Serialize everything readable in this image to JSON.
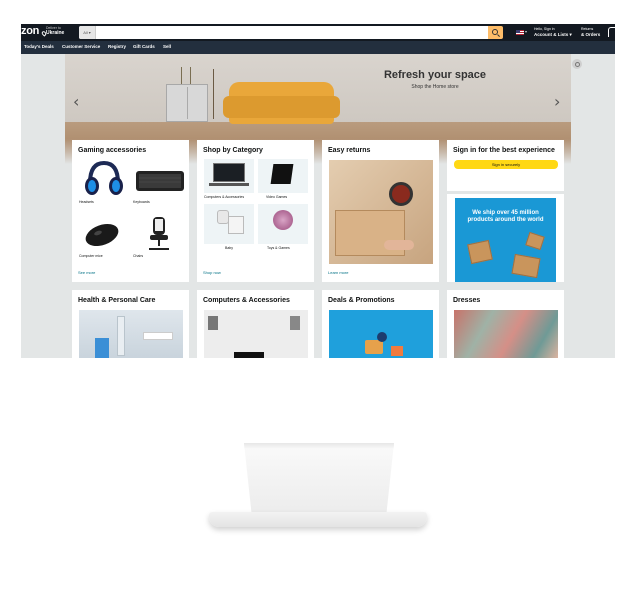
{
  "header": {
    "logo_text": "zon",
    "deliver_label": "Deliver to",
    "deliver_location": "Ukraine",
    "search_category": "All ▾",
    "search_placeholder": "",
    "account_greeting": "Hello, Sign in",
    "account_label": "Account & Lists ▾",
    "returns_label": "Returns",
    "orders_label": "& Orders",
    "flag_dropdown": "▾"
  },
  "subnav": {
    "items": [
      "Today's Deals",
      "Customer Service",
      "Registry",
      "Gift Cards",
      "Sell"
    ]
  },
  "hero": {
    "title": "Refresh your space",
    "subtitle": "Shop the Home store",
    "prev_arrow": "‹",
    "next_arrow": "›"
  },
  "cards": {
    "gaming": {
      "title": "Gaming accessories",
      "cells": [
        "Headsets",
        "Keyboards",
        "Computer mice",
        "Chairs"
      ],
      "link": "See more"
    },
    "category": {
      "title": "Shop by Category",
      "cells": [
        "Computers & Accessories",
        "Video Games",
        "Baby",
        "Toys & Games"
      ],
      "link": "Shop now"
    },
    "returns": {
      "title": "Easy returns",
      "link": "Learn more"
    },
    "signin": {
      "title": "Sign in for the best experience",
      "button": "Sign in securely",
      "promo_text": "We ship over 45 million products around the world"
    },
    "row2": [
      {
        "title": "Health & Personal Care"
      },
      {
        "title": "Computers & Accessories"
      },
      {
        "title": "Deals & Promotions"
      },
      {
        "title": "Dresses"
      }
    ]
  },
  "colors": {
    "nav_dark": "#131921",
    "nav_sub": "#232f3e",
    "search_button": "#febd69",
    "signin_button": "#ffd814",
    "link": "#007185",
    "promo_bg": "#1a98d5",
    "page_bg": "#e3e6e6"
  }
}
